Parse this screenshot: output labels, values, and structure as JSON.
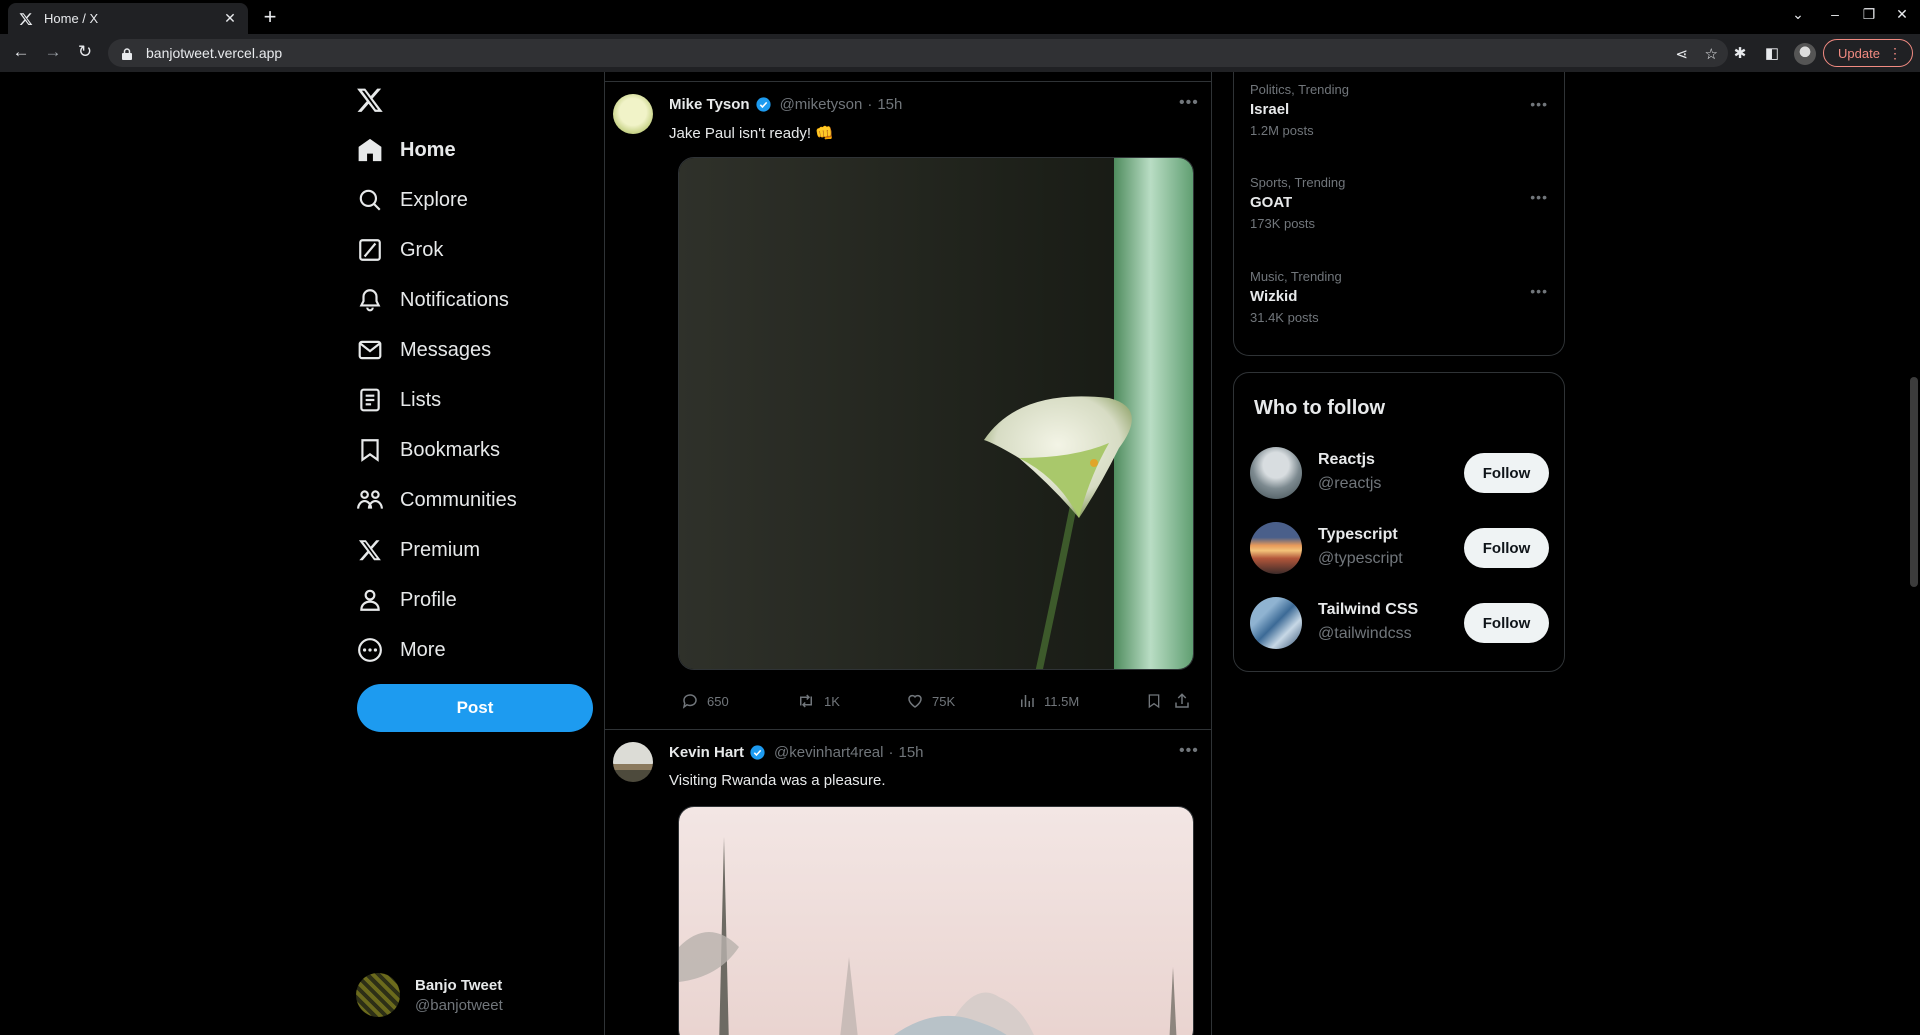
{
  "browser": {
    "tab_title": "Home / X",
    "tab_close": "✕",
    "new_tab": "+",
    "url": "banjotweet.vercel.app",
    "update_label": "Update"
  },
  "nav": {
    "items": [
      {
        "label": "Home",
        "icon": "home-icon"
      },
      {
        "label": "Explore",
        "icon": "search-icon"
      },
      {
        "label": "Grok",
        "icon": "grok-icon"
      },
      {
        "label": "Notifications",
        "icon": "bell-icon"
      },
      {
        "label": "Messages",
        "icon": "envelope-icon"
      },
      {
        "label": "Lists",
        "icon": "list-icon"
      },
      {
        "label": "Bookmarks",
        "icon": "bookmark-icon"
      },
      {
        "label": "Communities",
        "icon": "communities-icon"
      },
      {
        "label": "Premium",
        "icon": "x-icon"
      },
      {
        "label": "Profile",
        "icon": "person-icon"
      },
      {
        "label": "More",
        "icon": "more-circle-icon"
      }
    ],
    "post_label": "Post",
    "account": {
      "name": "Banjo Tweet",
      "handle": "@banjotweet"
    }
  },
  "feed": {
    "tweets": [
      {
        "name": "Mike Tyson",
        "handle": "@miketyson",
        "dot": "·",
        "time": "15h",
        "text": "Jake Paul isn't ready! 👊",
        "replies": "650",
        "retweets": "1K",
        "likes": "75K",
        "views": "11.5M"
      },
      {
        "name": "Kevin Hart",
        "handle": "@kevinhart4real",
        "dot": "·",
        "time": "15h",
        "text": "Visiting Rwanda was a pleasure."
      }
    ]
  },
  "trends": [
    {
      "category": "Politics, Trending",
      "name": "Israel",
      "count": "1.2M posts"
    },
    {
      "category": "Sports, Trending",
      "name": "GOAT",
      "count": "173K posts"
    },
    {
      "category": "Music, Trending",
      "name": "Wizkid",
      "count": "31.4K posts"
    }
  ],
  "who_to_follow": {
    "title": "Who to follow",
    "follow_label": "Follow",
    "accounts": [
      {
        "name": "Reactjs",
        "handle": "@reactjs"
      },
      {
        "name": "Typescript",
        "handle": "@typescript"
      },
      {
        "name": "Tailwind CSS",
        "handle": "@tailwindcss"
      }
    ]
  },
  "colors": {
    "accent": "#1d9bf0",
    "background": "#000000",
    "muted_text": "#71767b",
    "border": "#2f3336"
  }
}
